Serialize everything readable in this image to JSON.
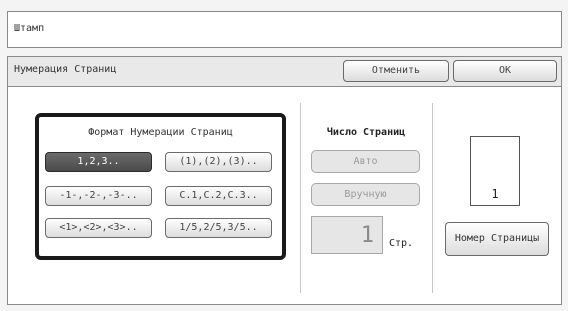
{
  "stamp": {
    "title": "Штамп"
  },
  "header": {
    "title": "Нумерация Страниц",
    "cancel_label": "Отменить",
    "ok_label": "OK"
  },
  "format": {
    "title": "Формат Нумерации Страниц",
    "options": [
      {
        "label": "1,2,3..",
        "selected": true
      },
      {
        "label": "(1),(2),(3)..",
        "selected": false
      },
      {
        "label": "-1-,-2-,-3-..",
        "selected": false
      },
      {
        "label": "C.1,C.2,C.3..",
        "selected": false
      },
      {
        "label": "<1>,<2>,<3>..",
        "selected": false
      },
      {
        "label": "1/5,2/5,3/5..",
        "selected": false
      }
    ]
  },
  "page_count": {
    "title": "Число Страниц",
    "auto_label": "Авто",
    "manual_label": "Вручную",
    "value": "1",
    "unit": "Стр."
  },
  "preview": {
    "number": "1",
    "page_number_button": "Номер Страницы"
  }
}
